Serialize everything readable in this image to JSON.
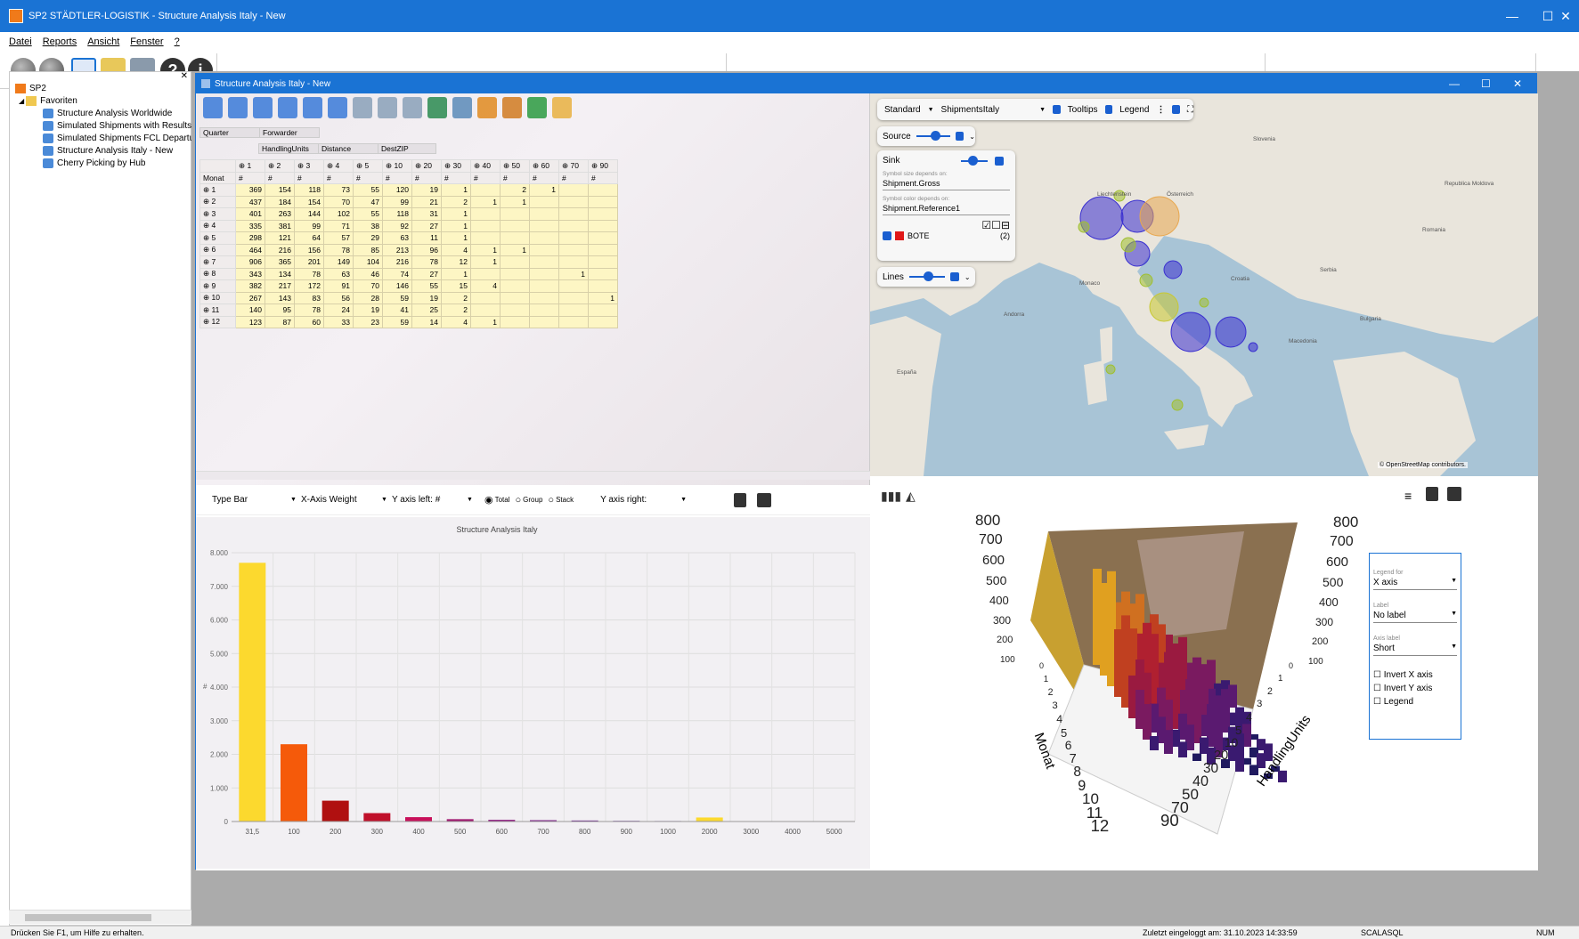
{
  "window": {
    "title": "SP2 STÄDTLER-LOGISTIK - Structure Analysis Italy - New",
    "minimize": "—",
    "maximize": "☐",
    "close": "✕"
  },
  "menu": [
    "Datei",
    "Reports",
    "Ansicht",
    "Fenster",
    "?"
  ],
  "toolbar_icons": [
    "check-icon",
    "cancel-icon",
    "cube-icon",
    "hierarchy-icon",
    "table-icon",
    "help-icon",
    "info-icon"
  ],
  "tree": {
    "root": "SP2",
    "folder": "Favoriten",
    "items": [
      "Structure Analysis Worldwide",
      "Simulated Shipments with Results -",
      "Simulated Shipments FCL Departur",
      "Structure Analysis Italy - New",
      "Cherry Picking by Hub"
    ]
  },
  "child": {
    "title": "Structure Analysis Italy - New"
  },
  "pivot": {
    "row_fields": [
      "Quarter",
      "Forwarder"
    ],
    "col_fields": [
      "HandlingUnits",
      "Distance",
      "DestZIP"
    ],
    "row_label": "Monat",
    "col_headers": [
      "1",
      "2",
      "3",
      "4",
      "5",
      "10",
      "20",
      "30",
      "40",
      "50",
      "60",
      "70",
      "90"
    ],
    "unit": "#",
    "rows": [
      {
        "m": "1",
        "v": [
          "369",
          "154",
          "118",
          "73",
          "55",
          "120",
          "19",
          "1",
          "",
          "2",
          "1",
          "",
          ""
        ]
      },
      {
        "m": "2",
        "v": [
          "437",
          "184",
          "154",
          "70",
          "47",
          "99",
          "21",
          "2",
          "1",
          "1",
          "",
          "",
          ""
        ]
      },
      {
        "m": "3",
        "v": [
          "401",
          "263",
          "144",
          "102",
          "55",
          "118",
          "31",
          "1",
          "",
          "",
          "",
          "",
          ""
        ]
      },
      {
        "m": "4",
        "v": [
          "335",
          "381",
          "99",
          "71",
          "38",
          "92",
          "27",
          "1",
          "",
          "",
          "",
          "",
          ""
        ]
      },
      {
        "m": "5",
        "v": [
          "298",
          "121",
          "64",
          "57",
          "29",
          "63",
          "11",
          "1",
          "",
          "",
          "",
          "",
          ""
        ]
      },
      {
        "m": "6",
        "v": [
          "464",
          "216",
          "156",
          "78",
          "85",
          "213",
          "96",
          "4",
          "1",
          "1",
          "",
          "",
          ""
        ]
      },
      {
        "m": "7",
        "v": [
          "906",
          "365",
          "201",
          "149",
          "104",
          "216",
          "78",
          "12",
          "1",
          "",
          "",
          "",
          ""
        ]
      },
      {
        "m": "8",
        "v": [
          "343",
          "134",
          "78",
          "63",
          "46",
          "74",
          "27",
          "1",
          "",
          "",
          "",
          "1",
          ""
        ]
      },
      {
        "m": "9",
        "v": [
          "382",
          "217",
          "172",
          "91",
          "70",
          "146",
          "55",
          "15",
          "4",
          "",
          "",
          "",
          ""
        ]
      },
      {
        "m": "10",
        "v": [
          "267",
          "143",
          "83",
          "56",
          "28",
          "59",
          "19",
          "2",
          "",
          "",
          "",
          "",
          "1"
        ]
      },
      {
        "m": "11",
        "v": [
          "140",
          "95",
          "78",
          "24",
          "19",
          "41",
          "25",
          "2",
          "",
          "",
          "",
          "",
          ""
        ]
      },
      {
        "m": "12",
        "v": [
          "123",
          "87",
          "60",
          "33",
          "23",
          "59",
          "14",
          "4",
          "1",
          "",
          "",
          "",
          ""
        ]
      }
    ]
  },
  "map": {
    "mode": "Standard",
    "layer": "ShipmentsItaly",
    "tooltips": "Tooltips",
    "legend": "Legend",
    "source": "Source",
    "sink": "Sink",
    "size_hint": "Symbol size depends on:",
    "size_value": "Shipment.Gross",
    "color_hint": "Symbol color depends on:",
    "color_value": "Shipment.Reference1",
    "legend_item": "BOTE",
    "legend_count": "(2)",
    "lines": "Lines",
    "attribution": "© OpenStreetMap contributors.",
    "places": [
      "Slovenia",
      "Romania",
      "Serbia",
      "Bulgaria",
      "Macedonia",
      "Croatia",
      "Republica Moldova",
      "España",
      "Andorra",
      "Monaco",
      "Österreich",
      "Liechtenstein"
    ]
  },
  "chart_controls": {
    "type": "Type Bar",
    "xaxis": "X-Axis Weight",
    "yleft": "Y axis left: #",
    "total": "Total",
    "group": "Group",
    "stack": "Stack",
    "yright": "Y axis right:"
  },
  "chart_data": {
    "type": "bar",
    "title": "Structure Analysis Italy",
    "categories": [
      "31,5",
      "100",
      "200",
      "300",
      "400",
      "500",
      "600",
      "700",
      "800",
      "900",
      "1000",
      "2000",
      "3000",
      "4000",
      "5000"
    ],
    "values": [
      7700,
      2300,
      620,
      250,
      130,
      70,
      50,
      40,
      30,
      20,
      15,
      120,
      0,
      0,
      0
    ],
    "colors": [
      "#fcd92e",
      "#f55a0a",
      "#b01010",
      "#c0102a",
      "#c8105a",
      "#a01870",
      "#901a80",
      "#80208a",
      "#702090",
      "#602090",
      "#502090",
      "#fcd92e",
      "#ffffff",
      "#ffffff",
      "#ffffff"
    ],
    "yticks": [
      "0",
      "1.000",
      "2.000",
      "3.000",
      "4.000",
      "5.000",
      "6.000",
      "7.000",
      "8.000"
    ],
    "ylim": [
      0,
      8000
    ],
    "ylabel": "#"
  },
  "p3d": {
    "legend_for_label": "Legend for",
    "legend_for": "X axis",
    "label_label": "Label",
    "label": "No label",
    "axis_label_label": "Axis label",
    "axis_label": "Short",
    "invert_x": "Invert X axis",
    "invert_y": "Invert Y axis",
    "legend": "Legend",
    "left_ticks": [
      "800",
      "700",
      "600",
      "500",
      "400",
      "300",
      "200",
      "100"
    ],
    "right_ticks": [
      "800",
      "700",
      "600",
      "500",
      "400",
      "300",
      "200",
      "100"
    ],
    "monat_ticks": [
      "0",
      "1",
      "2",
      "3",
      "4",
      "5",
      "6",
      "7",
      "8",
      "9",
      "10",
      "11",
      "12"
    ],
    "hu_ticks": [
      "0",
      "1",
      "2",
      "3",
      "4",
      "5",
      "10",
      "20",
      "30",
      "40",
      "50",
      "70",
      "90"
    ],
    "monat_title": "Monat",
    "hu_title": "HandlingUnits"
  },
  "status": {
    "help": "Drücken Sie F1, um Hilfe zu erhalten.",
    "login": "Zuletzt eingeloggt am: 31.10.2023 14:33:59",
    "db": "SCALASQL",
    "num": "NUM"
  }
}
